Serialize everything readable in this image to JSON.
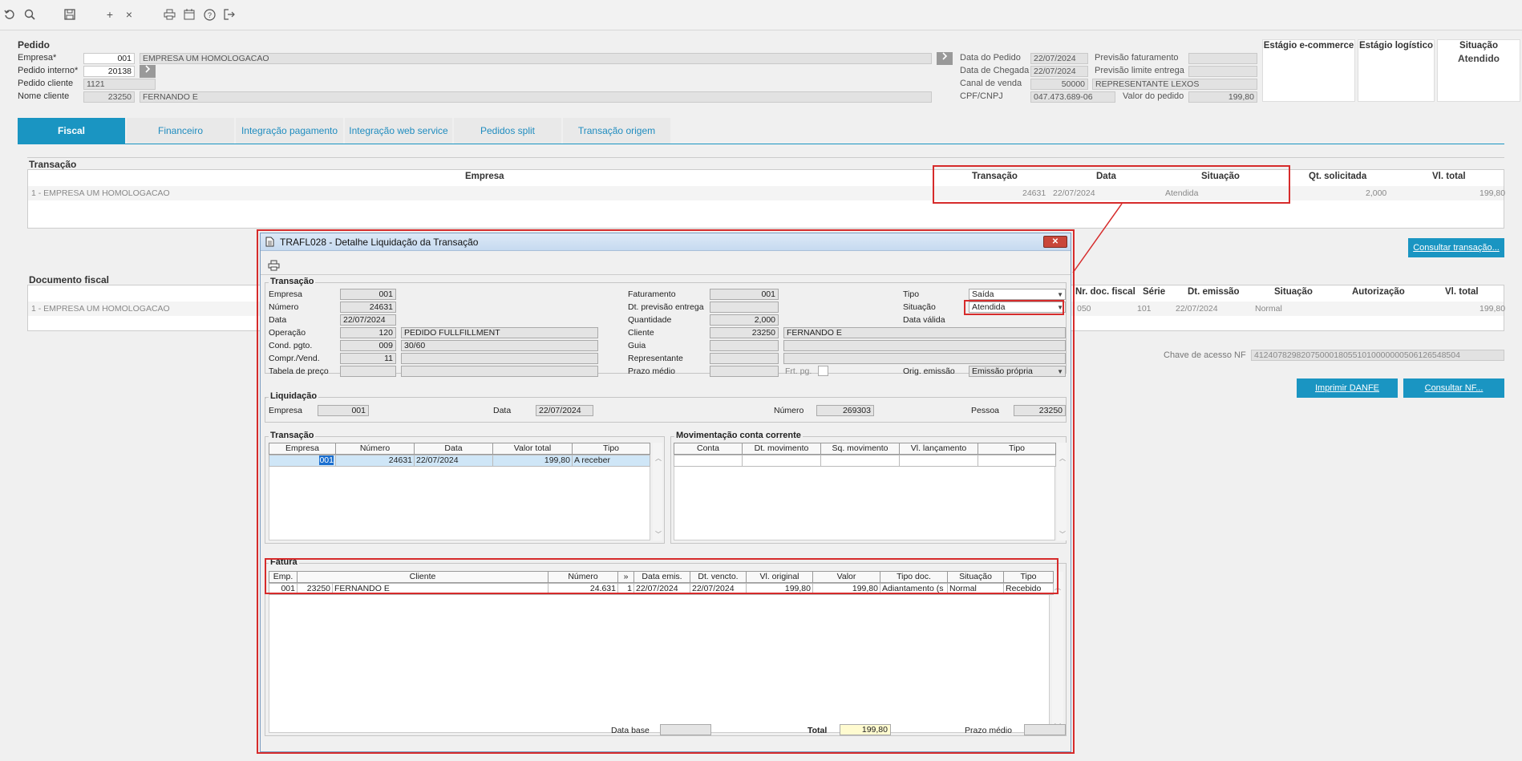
{
  "toolbar": {
    "icons": [
      "undo-icon",
      "search-icon",
      "save-icon",
      "add-icon",
      "close-icon",
      "print-icon",
      "calendar-icon",
      "help-icon",
      "exit-icon"
    ],
    "plus": "+",
    "times": "×"
  },
  "pedido": {
    "section_title": "Pedido",
    "empresa_label": "Empresa*",
    "empresa_code": "001",
    "empresa_name": "EMPRESA UM HOMOLOGACAO",
    "pedido_interno_label": "Pedido interno*",
    "pedido_interno": "20138",
    "pedido_cliente_label": "Pedido cliente",
    "pedido_cliente": "1121",
    "nome_cliente_label": "Nome cliente",
    "cliente_code": "23250",
    "cliente_name": "FERNANDO E",
    "data_pedido_label": "Data do Pedido",
    "data_pedido": "22/07/2024",
    "data_chegada_label": "Data de Chegada",
    "data_chegada": "22/07/2024",
    "canal_venda_label": "Canal de venda",
    "canal_venda_code": "50000",
    "canal_venda_name": "REPRESENTANTE LEXOS",
    "cpf_label": "CPF/CNPJ",
    "cpf": "047.473.689-06",
    "previsao_fat_label": "Previsão faturamento",
    "previsao_limite_label": "Previsão limite entrega",
    "valor_pedido_label": "Valor do pedido",
    "valor_pedido": "199,80",
    "estagio_ecommerce_label": "Estágio e-commerce",
    "estagio_logistico_label": "Estágio logístico",
    "situacao_label": "Situação",
    "situacao_value": "Atendido"
  },
  "tabs": [
    "Fiscal",
    "Financeiro",
    "Integração pagamento",
    "Integração web service",
    "Pedidos split",
    "Transação origem"
  ],
  "transacao_section": {
    "title": "Transação",
    "headers": [
      "Empresa",
      "Transação",
      "Data",
      "Situação",
      "Qt. solicitada",
      "Vl. total"
    ],
    "row": {
      "empresa": "1 - EMPRESA UM HOMOLOGACAO",
      "transacao": "24631",
      "data": "22/07/2024",
      "situacao": "Atendida",
      "qt": "2,000",
      "vl": "199,80"
    },
    "consultar_btn": "Consultar transação..."
  },
  "documento_section": {
    "title": "Documento fiscal",
    "headers": [
      "Nr. doc. fiscal",
      "Série",
      "Dt. emissão",
      "Situação",
      "Autorização",
      "Vl. total"
    ],
    "row": {
      "empresa": "1 - EMPRESA UM HOMOLOGACAO",
      "nr": "050",
      "serie": "101",
      "dt": "22/07/2024",
      "situacao": "Normal",
      "vl": "199,80"
    },
    "chave_label": "Chave de acesso NF",
    "chave": "41240782982075000180551010000000506126548504",
    "imprimir_btn": "Imprimir DANFE",
    "consultar_nf_btn": "Consultar NF..."
  },
  "dialog": {
    "title": "TRAFL028 - Detalhe Liquidação da Transação",
    "close": "✕",
    "transacao_group": "Transação",
    "empresa_label": "Empresa",
    "empresa": "001",
    "numero_label": "Número",
    "numero": "24631",
    "data_label": "Data",
    "data": "22/07/2024",
    "operacao_label": "Operação",
    "operacao_code": "120",
    "operacao_name": "PEDIDO FULLFILLMENT",
    "cond_label": "Cond. pgto.",
    "cond_code": "009",
    "cond_name": "30/60",
    "compr_label": "Compr./Vend.",
    "compr": "11",
    "tabela_label": "Tabela de preço",
    "faturamento_label": "Faturamento",
    "faturamento": "001",
    "dt_prev_label": "Dt. previsão entrega",
    "quantidade_label": "Quantidade",
    "quantidade": "2,000",
    "cliente_label": "Cliente",
    "cliente_code": "23250",
    "cliente_name": "FERNANDO E",
    "guia_label": "Guia",
    "representante_label": "Representante",
    "prazo_label": "Prazo médio",
    "frt_label": "Frt. pg.",
    "tipo_label": "Tipo",
    "tipo": "Saída",
    "situacao_label": "Situação",
    "situacao": "Atendida",
    "data_valida_label": "Data válida",
    "orig_label": "Orig. emissão",
    "orig": "Emissão própria",
    "liquidacao_group": "Liquidação",
    "liq_empresa_label": "Empresa",
    "liq_empresa": "001",
    "liq_data_label": "Data",
    "liq_data": "22/07/2024",
    "liq_numero_label": "Número",
    "liq_numero": "269303",
    "liq_pessoa_label": "Pessoa",
    "liq_pessoa": "23250",
    "trans_grid_group": "Transação",
    "trans_grid_headers": [
      "Empresa",
      "Número",
      "Data",
      "Valor total",
      "Tipo"
    ],
    "trans_grid_row": [
      "001",
      "24631",
      "22/07/2024",
      "199,80",
      "A receber"
    ],
    "mov_group": "Movimentação conta corrente",
    "mov_headers": [
      "Conta",
      "Dt. movimento",
      "Sq. movimento",
      "Vl. lançamento",
      "Tipo"
    ],
    "fatura_group": "Fatura",
    "fatura_headers": [
      "Emp.",
      "Cliente",
      "Número",
      "»",
      "Data emis.",
      "Dt. vencto.",
      "Vl. original",
      "Valor",
      "Tipo doc.",
      "Situação",
      "Tipo"
    ],
    "fatura_row": [
      "001",
      "23250",
      "FERNANDO E",
      "24.631",
      "1",
      "22/07/2024",
      "22/07/2024",
      "199,80",
      "199,80",
      "Adiantamento (s",
      "Normal",
      "Recebido"
    ],
    "data_base_label": "Data base",
    "total_label": "Total",
    "total": "199,80",
    "prazo_medio_label": "Prazo médio"
  }
}
